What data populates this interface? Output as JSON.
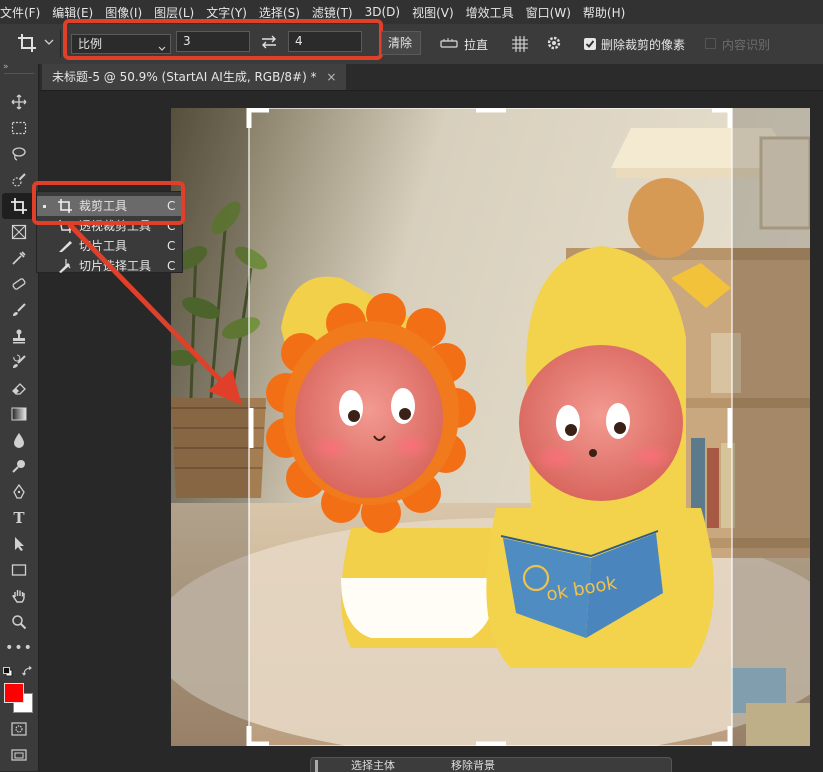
{
  "menu": {
    "items": [
      "文件(F)",
      "编辑(E)",
      "图像(I)",
      "图层(L)",
      "文字(Y)",
      "选择(S)",
      "滤镜(T)",
      "3D(D)",
      "视图(V)",
      "增效工具",
      "窗口(W)",
      "帮助(H)"
    ]
  },
  "options": {
    "ratio_select": "比例",
    "width_value": "3",
    "height_value": "4",
    "clear_label": "清除",
    "straighten_label": "拉直",
    "delete_cropped_label": "删除裁剪的像素",
    "delete_cropped_checked": true,
    "content_aware_label": "内容识别",
    "content_aware_checked": false
  },
  "document": {
    "tab_title": "未标题-5 @ 50.9% (StartAI AI生成, RGB/8#) *",
    "close_glyph": "×"
  },
  "flyout": {
    "items": [
      {
        "label": "裁剪工具",
        "shortcut": "C",
        "active": true
      },
      {
        "label": "透视裁剪工具",
        "shortcut": "C",
        "active": false
      },
      {
        "label": "切片工具",
        "shortcut": "C",
        "active": false
      },
      {
        "label": "切片选择工具",
        "shortcut": "C",
        "active": false
      }
    ]
  },
  "photo": {
    "book_text": "ok book"
  },
  "colors": {
    "foreground": "#ff0000",
    "background": "#ffffff",
    "highlight": "#e0402a"
  },
  "bottombar": {
    "select_subject_label": "选择主体",
    "remove_bg_label": "移除背景"
  }
}
